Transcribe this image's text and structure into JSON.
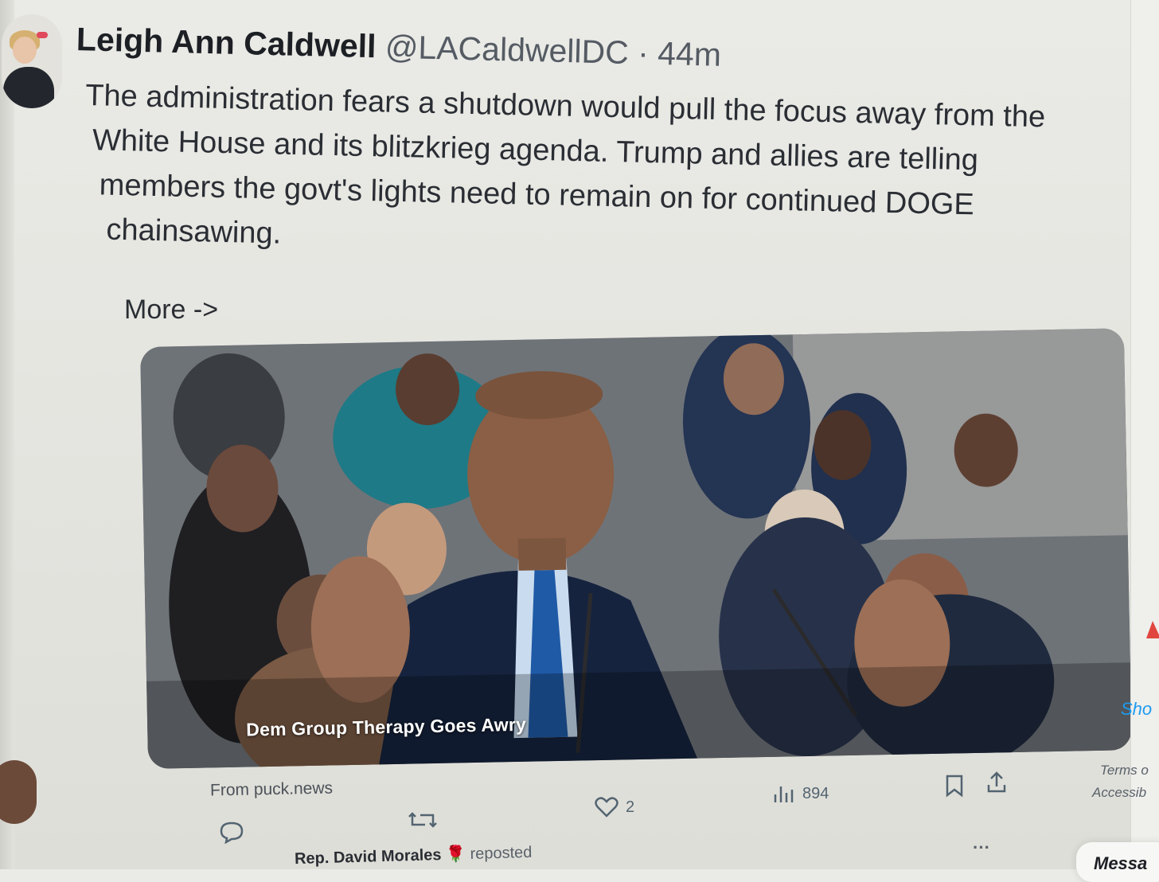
{
  "tweet": {
    "author_name": "Leigh Ann Caldwell",
    "author_handle": "@LACaldwellDC",
    "separator": "·",
    "timestamp": "44m",
    "text_lines": [
      "The administration fears a shutdown would pull the focus away from the",
      "White House and its blitzkrieg agenda. Trump and allies are telling",
      "members the govt's lights need to remain on for continued DOGE",
      "chainsawing."
    ],
    "more_link": "More ->"
  },
  "card": {
    "caption": "Dem Group Therapy Goes Awry",
    "source": "From puck.news"
  },
  "actions": {
    "reply_icon": "reply-icon",
    "retweet_icon": "retweet-icon",
    "like_icon": "heart-icon",
    "like_count": "2",
    "views_icon": "views-bar-chart-icon",
    "views_count": "894",
    "bookmark_icon": "bookmark-icon",
    "share_icon": "share-icon"
  },
  "next_post": {
    "reposter_partial": "Rep. David Morales",
    "reposted_label": "reposted",
    "emoji": "🌹",
    "more_menu": "···"
  },
  "right_sidebar": {
    "show_partial": "Sho",
    "terms_partial": "Terms o",
    "accessibility_partial": "Accessib",
    "messages_partial": "Messa"
  },
  "colors": {
    "link_blue": "#1d9bf0",
    "text_dark": "#2a2e34",
    "muted": "#536471"
  }
}
